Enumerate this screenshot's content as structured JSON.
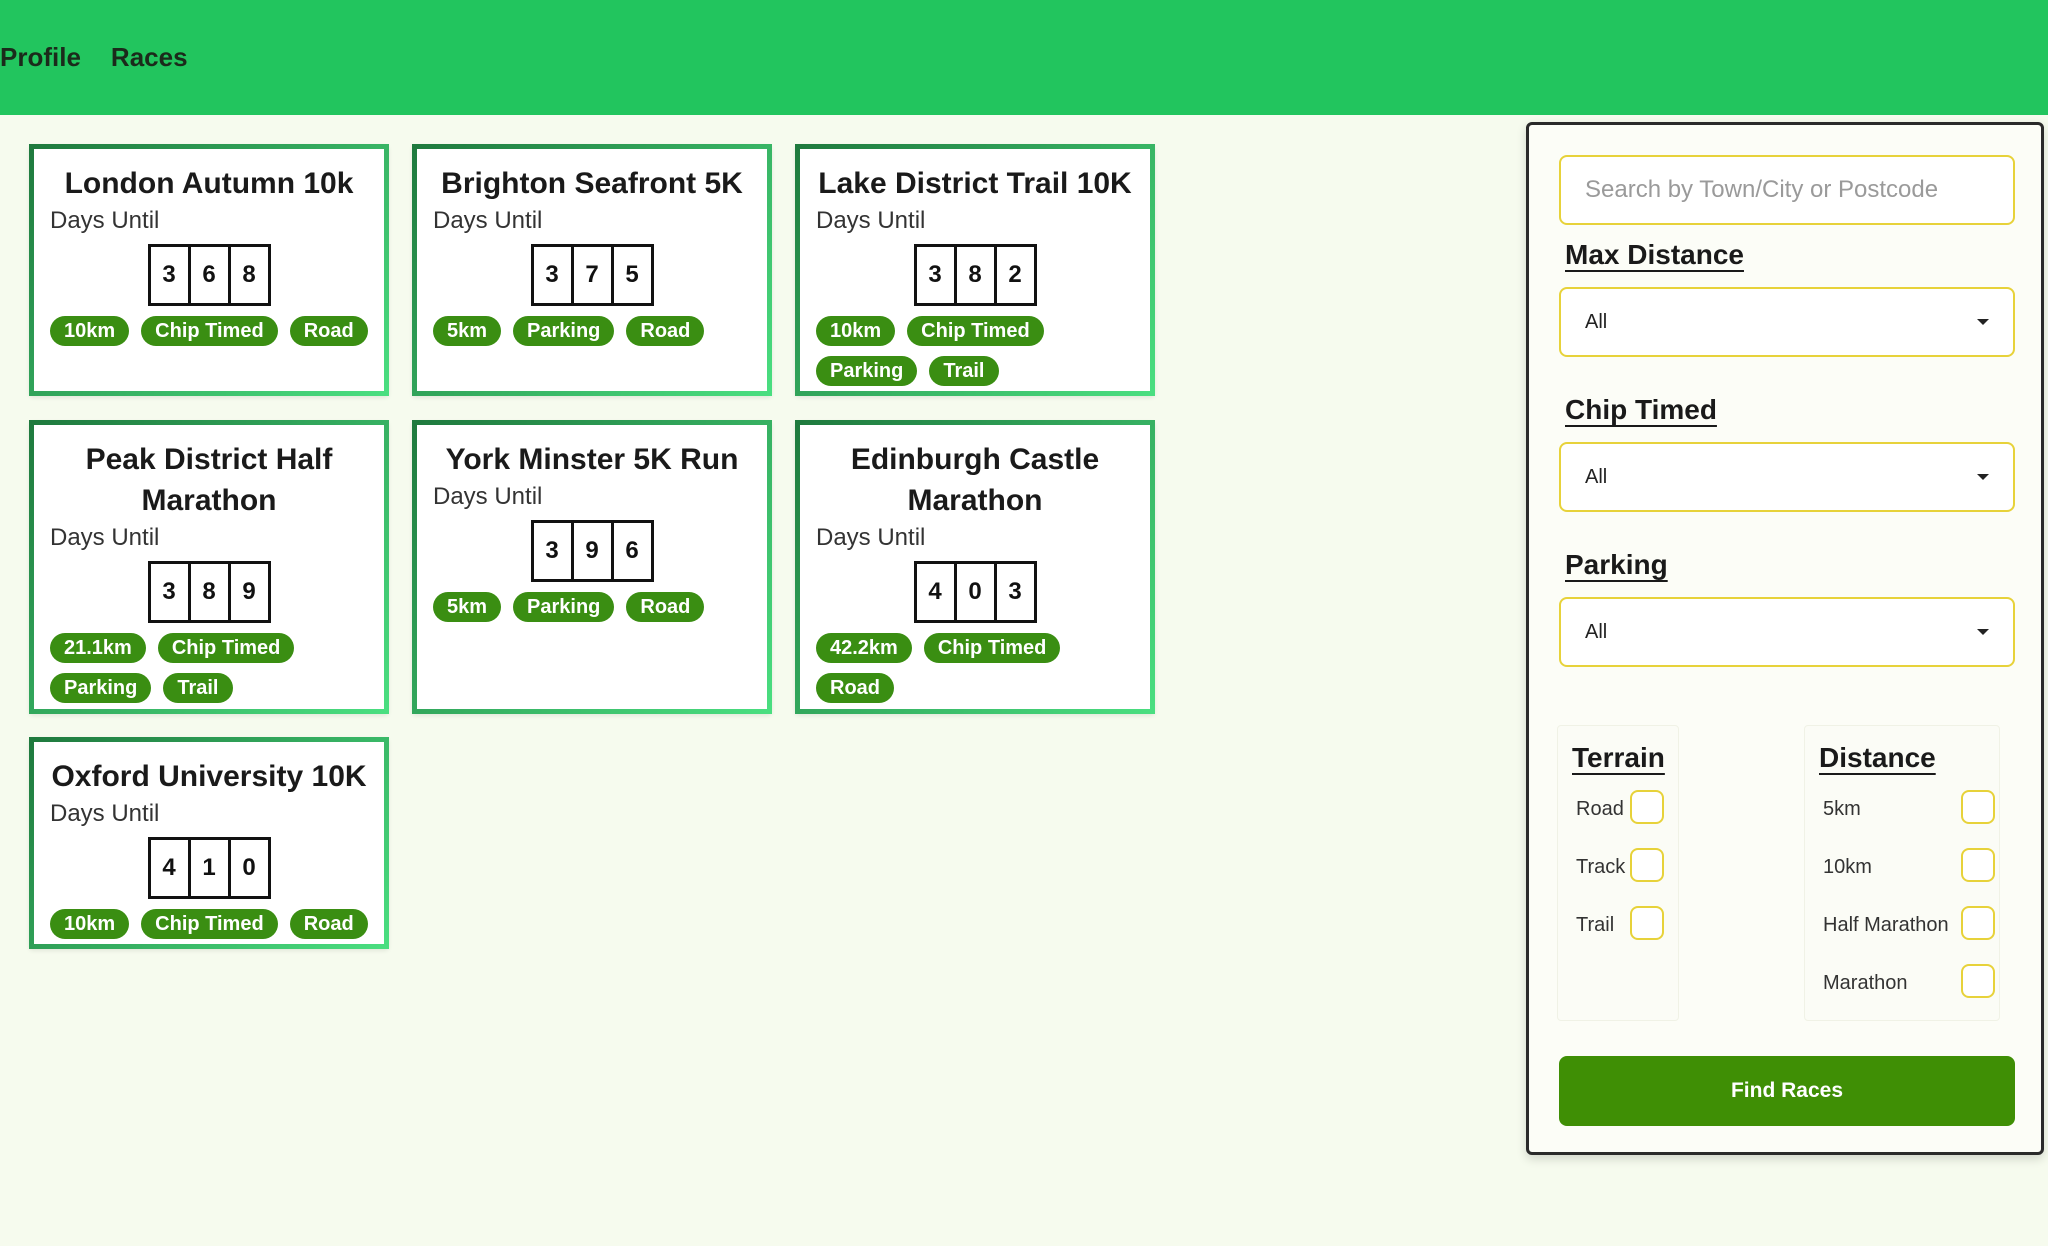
{
  "nav": {
    "items": [
      {
        "label": "Profile"
      },
      {
        "label": "Races"
      }
    ]
  },
  "races": [
    {
      "title": "London Autumn 10k",
      "days_label": "Days Until",
      "digits": [
        "3",
        "6",
        "8"
      ],
      "tags": [
        "10km",
        "Chip Timed",
        "Road"
      ]
    },
    {
      "title": "Brighton Seafront 5K",
      "days_label": "Days Until",
      "digits": [
        "3",
        "7",
        "5"
      ],
      "tags": [
        "5km",
        "Parking",
        "Road"
      ]
    },
    {
      "title": "Lake District Trail 10K",
      "days_label": "Days Until",
      "digits": [
        "3",
        "8",
        "2"
      ],
      "tags": [
        "10km",
        "Chip Timed",
        "Parking",
        "Trail"
      ]
    },
    {
      "title": "Peak District Half Marathon",
      "days_label": "Days Until",
      "digits": [
        "3",
        "8",
        "9"
      ],
      "tags": [
        "21.1km",
        "Chip Timed",
        "Parking",
        "Trail"
      ]
    },
    {
      "title": "York Minster 5K Run",
      "days_label": "Days Until",
      "digits": [
        "3",
        "9",
        "6"
      ],
      "tags": [
        "5km",
        "Parking",
        "Road"
      ]
    },
    {
      "title": "Edinburgh Castle Marathon",
      "days_label": "Days Until",
      "digits": [
        "4",
        "0",
        "3"
      ],
      "tags": [
        "42.2km",
        "Chip Timed",
        "Road"
      ]
    },
    {
      "title": "Oxford University 10K",
      "days_label": "Days Until",
      "digits": [
        "4",
        "1",
        "0"
      ],
      "tags": [
        "10km",
        "Chip Timed",
        "Road"
      ]
    }
  ],
  "filters": {
    "search": {
      "placeholder": "Search by Town/City or Postcode",
      "value": ""
    },
    "max_distance": {
      "label": "Max Distance",
      "value": "All"
    },
    "chip_timed": {
      "label": "Chip Timed",
      "value": "All"
    },
    "parking": {
      "label": "Parking",
      "value": "All"
    },
    "terrain": {
      "title": "Terrain",
      "options": [
        {
          "label": "Road",
          "checked": false
        },
        {
          "label": "Track",
          "checked": false
        },
        {
          "label": "Trail",
          "checked": false
        }
      ]
    },
    "distance": {
      "title": "Distance",
      "options": [
        {
          "label": "5km",
          "checked": false
        },
        {
          "label": "10km",
          "checked": false
        },
        {
          "label": "Half Marathon",
          "checked": false
        },
        {
          "label": "Marathon",
          "checked": false
        }
      ]
    },
    "find_button": "Find Races"
  },
  "colors": {
    "nav_bg": "#22c55e",
    "page_bg": "#f6fbee",
    "tag_bg": "#3a8e12",
    "button_bg": "#3f8f05",
    "input_border": "#e7d23a"
  }
}
